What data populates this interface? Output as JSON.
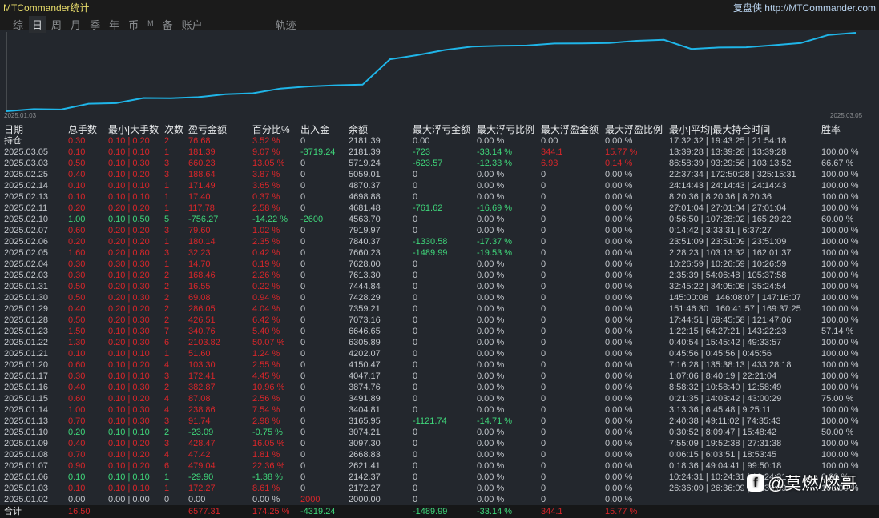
{
  "header": {
    "title": "MTCommander统计",
    "brand": "复盘侠 http://MTCommander.com"
  },
  "tabs": [
    "综",
    "日",
    "周",
    "月",
    "季",
    "年",
    "币",
    "M",
    "备",
    "账户",
    "轨迹"
  ],
  "active_tab": "日",
  "chart": {
    "start_label": "2025.01.03",
    "end_label": "2025.03.05",
    "line_color": "#1fb5e8"
  },
  "colors": {
    "profit": "#d8262a",
    "loss": "#3fd67a",
    "neutral": "#c3c7cc"
  },
  "table": {
    "columns": [
      "日期",
      "总手数",
      "最小|大手数",
      "次数",
      "盈亏金额",
      "百分比%",
      "出入金",
      "余额",
      "最大浮亏金额",
      "最大浮亏比例",
      "最大浮盈金额",
      "最大浮盈比例",
      "最小|平均|最大持仓时间",
      "胜率"
    ],
    "holding": [
      "持仓",
      "0.30",
      "0.10 | 0.20",
      "2",
      "76.68",
      "3.52 %",
      "0",
      "2181.39",
      "0.00",
      "0.00 %",
      "0.00",
      "0.00 %",
      "17:32:32 | 19:43:25 | 21:54:18",
      ""
    ],
    "rows": [
      [
        "2025.03.05",
        "0.10",
        "0.10 | 0.10",
        "1",
        "181.39",
        "9.07 %",
        "-3719.24",
        "2181.39",
        "-723",
        "-33.14 %",
        "344.1",
        "15.77 %",
        "13:39:28 | 13:39:28 | 13:39:28",
        "100.00 %"
      ],
      [
        "2025.03.03",
        "0.50",
        "0.10 | 0.30",
        "3",
        "660.23",
        "13.05 %",
        "0",
        "5719.24",
        "-623.57",
        "-12.33 %",
        "6.93",
        "0.14 %",
        "86:58:39 | 93:29:56 | 103:13:52",
        "66.67 %"
      ],
      [
        "2025.02.25",
        "0.40",
        "0.10 | 0.20",
        "3",
        "188.64",
        "3.87 %",
        "0",
        "5059.01",
        "0",
        "0.00 %",
        "0",
        "0.00 %",
        "22:37:34 | 172:50:28 | 325:15:31",
        "100.00 %"
      ],
      [
        "2025.02.14",
        "0.10",
        "0.10 | 0.10",
        "1",
        "171.49",
        "3.65 %",
        "0",
        "4870.37",
        "0",
        "0.00 %",
        "0",
        "0.00 %",
        "24:14:43 | 24:14:43 | 24:14:43",
        "100.00 %"
      ],
      [
        "2025.02.13",
        "0.10",
        "0.10 | 0.10",
        "1",
        "17.40",
        "0.37 %",
        "0",
        "4698.88",
        "0",
        "0.00 %",
        "0",
        "0.00 %",
        "8:20:36 | 8:20:36 | 8:20:36",
        "100.00 %"
      ],
      [
        "2025.02.11",
        "0.20",
        "0.20 | 0.20",
        "1",
        "117.78",
        "2.58 %",
        "0",
        "4681.48",
        "-761.62",
        "-16.69 %",
        "0",
        "0.00 %",
        "27:01:04 | 27:01:04 | 27:01:04",
        "100.00 %"
      ],
      [
        "2025.02.10",
        "1.00",
        "0.10 | 0.50",
        "5",
        "-756.27",
        "-14.22 %",
        "-2600",
        "4563.70",
        "0",
        "0.00 %",
        "0",
        "0.00 %",
        "0:56:50 | 107:28:02 | 165:29:22",
        "60.00 %"
      ],
      [
        "2025.02.07",
        "0.60",
        "0.20 | 0.20",
        "3",
        "79.60",
        "1.02 %",
        "0",
        "7919.97",
        "0",
        "0.00 %",
        "0",
        "0.00 %",
        "0:14:42 | 3:33:31 | 6:37:27",
        "100.00 %"
      ],
      [
        "2025.02.06",
        "0.20",
        "0.20 | 0.20",
        "1",
        "180.14",
        "2.35 %",
        "0",
        "7840.37",
        "-1330.58",
        "-17.37 %",
        "0",
        "0.00 %",
        "23:51:09 | 23:51:09 | 23:51:09",
        "100.00 %"
      ],
      [
        "2025.02.05",
        "1.60",
        "0.20 | 0.80",
        "3",
        "32.23",
        "0.42 %",
        "0",
        "7660.23",
        "-1489.99",
        "-19.53 %",
        "0",
        "0.00 %",
        "2:28:23 | 103:13:32 | 162:01:37",
        "100.00 %"
      ],
      [
        "2025.02.04",
        "0.30",
        "0.30 | 0.30",
        "1",
        "14.70",
        "0.19 %",
        "0",
        "7628.00",
        "0",
        "0.00 %",
        "0",
        "0.00 %",
        "10:26:59 | 10:26:59 | 10:26:59",
        "100.00 %"
      ],
      [
        "2025.02.03",
        "0.30",
        "0.10 | 0.20",
        "2",
        "168.46",
        "2.26 %",
        "0",
        "7613.30",
        "0",
        "0.00 %",
        "0",
        "0.00 %",
        "2:35:39 | 54:06:48 | 105:37:58",
        "100.00 %"
      ],
      [
        "2025.01.31",
        "0.50",
        "0.20 | 0.30",
        "2",
        "16.55",
        "0.22 %",
        "0",
        "7444.84",
        "0",
        "0.00 %",
        "0",
        "0.00 %",
        "32:45:22 | 34:05:08 | 35:24:54",
        "100.00 %"
      ],
      [
        "2025.01.30",
        "0.50",
        "0.20 | 0.30",
        "2",
        "69.08",
        "0.94 %",
        "0",
        "7428.29",
        "0",
        "0.00 %",
        "0",
        "0.00 %",
        "145:00:08 | 146:08:07 | 147:16:07",
        "100.00 %"
      ],
      [
        "2025.01.29",
        "0.40",
        "0.20 | 0.20",
        "2",
        "286.05",
        "4.04 %",
        "0",
        "7359.21",
        "0",
        "0.00 %",
        "0",
        "0.00 %",
        "151:46:30 | 160:41:57 | 169:37:25",
        "100.00 %"
      ],
      [
        "2025.01.28",
        "0.50",
        "0.20 | 0.30",
        "2",
        "426.51",
        "6.42 %",
        "0",
        "7073.16",
        "0",
        "0.00 %",
        "0",
        "0.00 %",
        "17:44:51 | 69:45:58 | 121:47:06",
        "100.00 %"
      ],
      [
        "2025.01.23",
        "1.50",
        "0.10 | 0.30",
        "7",
        "340.76",
        "5.40 %",
        "0",
        "6646.65",
        "0",
        "0.00 %",
        "0",
        "0.00 %",
        "1:22:15 | 64:27:21 | 143:22:23",
        "57.14 %"
      ],
      [
        "2025.01.22",
        "1.30",
        "0.20 | 0.30",
        "6",
        "2103.82",
        "50.07 %",
        "0",
        "6305.89",
        "0",
        "0.00 %",
        "0",
        "0.00 %",
        "0:40:54 | 15:45:42 | 49:33:57",
        "100.00 %"
      ],
      [
        "2025.01.21",
        "0.10",
        "0.10 | 0.10",
        "1",
        "51.60",
        "1.24 %",
        "0",
        "4202.07",
        "0",
        "0.00 %",
        "0",
        "0.00 %",
        "0:45:56 | 0:45:56 | 0:45:56",
        "100.00 %"
      ],
      [
        "2025.01.20",
        "0.60",
        "0.10 | 0.20",
        "4",
        "103.30",
        "2.55 %",
        "0",
        "4150.47",
        "0",
        "0.00 %",
        "0",
        "0.00 %",
        "7:16:28 | 135:38:13 | 433:28:18",
        "100.00 %"
      ],
      [
        "2025.01.17",
        "0.30",
        "0.10 | 0.10",
        "3",
        "172.41",
        "4.45 %",
        "0",
        "4047.17",
        "0",
        "0.00 %",
        "0",
        "0.00 %",
        "1:07:06 | 8:40:19 | 22:21:04",
        "100.00 %"
      ],
      [
        "2025.01.16",
        "0.40",
        "0.10 | 0.30",
        "2",
        "382.87",
        "10.96 %",
        "0",
        "3874.76",
        "0",
        "0.00 %",
        "0",
        "0.00 %",
        "8:58:32 | 10:58:40 | 12:58:49",
        "100.00 %"
      ],
      [
        "2025.01.15",
        "0.60",
        "0.10 | 0.20",
        "4",
        "87.08",
        "2.56 %",
        "0",
        "3491.89",
        "0",
        "0.00 %",
        "0",
        "0.00 %",
        "0:21:35 | 14:03:42 | 43:00:29",
        "75.00 %"
      ],
      [
        "2025.01.14",
        "1.00",
        "0.10 | 0.30",
        "4",
        "238.86",
        "7.54 %",
        "0",
        "3404.81",
        "0",
        "0.00 %",
        "0",
        "0.00 %",
        "3:13:36 | 6:45:48 | 9:25:11",
        "100.00 %"
      ],
      [
        "2025.01.13",
        "0.70",
        "0.10 | 0.30",
        "3",
        "91.74",
        "2.98 %",
        "0",
        "3165.95",
        "-1121.74",
        "-14.71 %",
        "0",
        "0.00 %",
        "2:40:38 | 49:11:02 | 74:35:43",
        "100.00 %"
      ],
      [
        "2025.01.10",
        "0.20",
        "0.10 | 0.10",
        "2",
        "-23.09",
        "-0.75 %",
        "0",
        "3074.21",
        "0",
        "0.00 %",
        "0",
        "0.00 %",
        "0:30:52 | 8:09:47 | 15:48:42",
        "50.00 %"
      ],
      [
        "2025.01.09",
        "0.40",
        "0.10 | 0.20",
        "3",
        "428.47",
        "16.05 %",
        "0",
        "3097.30",
        "0",
        "0.00 %",
        "0",
        "0.00 %",
        "7:55:09 | 19:52:38 | 27:31:38",
        "100.00 %"
      ],
      [
        "2025.01.08",
        "0.70",
        "0.10 | 0.20",
        "4",
        "47.42",
        "1.81 %",
        "0",
        "2668.83",
        "0",
        "0.00 %",
        "0",
        "0.00 %",
        "0:06:15 | 6:03:51 | 18:53:45",
        "100.00 %"
      ],
      [
        "2025.01.07",
        "0.90",
        "0.10 | 0.20",
        "6",
        "479.04",
        "22.36 %",
        "0",
        "2621.41",
        "0",
        "0.00 %",
        "0",
        "0.00 %",
        "0:18:36 | 49:04:41 | 99:50:18",
        "100.00 %"
      ],
      [
        "2025.01.06",
        "0.10",
        "0.10 | 0.10",
        "1",
        "-29.90",
        "-1.38 %",
        "0",
        "2142.37",
        "0",
        "0.00 %",
        "0",
        "0.00 %",
        "10:24:31 | 10:24:31 | 10:24:31",
        "0.00 %"
      ],
      [
        "2025.01.03",
        "0.10",
        "0.10 | 0.10",
        "1",
        "172.27",
        "8.61 %",
        "0",
        "2172.27",
        "0",
        "0.00 %",
        "0",
        "0.00 %",
        "26:36:09 | 26:36:09 | 26:36:09",
        "100.00 %"
      ],
      [
        "2025.01.02",
        "0.00",
        "0.00 | 0.00",
        "0",
        "0.00",
        "0.00 %",
        "2000",
        "2000.00",
        "0",
        "0.00 %",
        "0",
        "0.00 %",
        "",
        ""
      ]
    ],
    "total": [
      "合计",
      "16.50",
      "",
      "",
      "6577.31",
      "174.25 %",
      "-4319.24",
      "",
      "-1489.99",
      "-33.14 %",
      "344.1",
      "15.77 %",
      "",
      ""
    ]
  },
  "watermark": "@莫燃/燃哥"
}
